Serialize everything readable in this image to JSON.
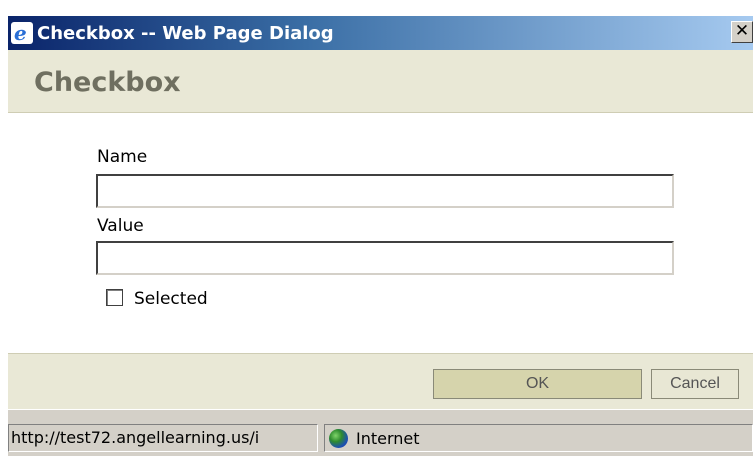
{
  "window": {
    "title": "Checkbox -- Web Page Dialog",
    "close_glyph": "✕"
  },
  "header": {
    "title": "Checkbox"
  },
  "form": {
    "name_label": "Name",
    "name_value": "",
    "value_label": "Value",
    "value_value": "",
    "selected_label": "Selected",
    "selected_checked": false
  },
  "buttons": {
    "ok_label": "OK",
    "cancel_label": "Cancel"
  },
  "statusbar": {
    "url": "http://test72.angellearning.us/i",
    "zone": "Internet"
  },
  "icons": {
    "app_icon": "internet-explorer-icon",
    "zone_icon": "globe-icon"
  },
  "colors": {
    "titlebar_start": "#0a246a",
    "titlebar_end": "#a6caf0",
    "band_bg": "#e9e8d6",
    "header_text": "#6f6f60",
    "ok_bg": "#d6d4ac"
  }
}
